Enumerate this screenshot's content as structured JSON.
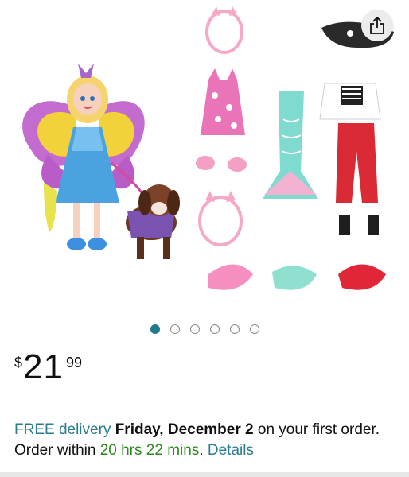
{
  "product": {
    "gallery": {
      "image_count": 6,
      "active_index": 0
    },
    "price": {
      "symbol": "$",
      "whole": "21",
      "fraction": "99"
    },
    "delivery": {
      "free_label": "FREE delivery",
      "date": "Friday, December 2",
      "suffix": " on your first order. Order within ",
      "countdown": "20 hrs 22 mins",
      "period": ". ",
      "details_link": "Details"
    }
  },
  "icons": {
    "share": "share-icon"
  },
  "colors": {
    "link": "#2a7c8f",
    "countdown": "#2a8a1c",
    "active_dot": "#1f7a8c"
  }
}
